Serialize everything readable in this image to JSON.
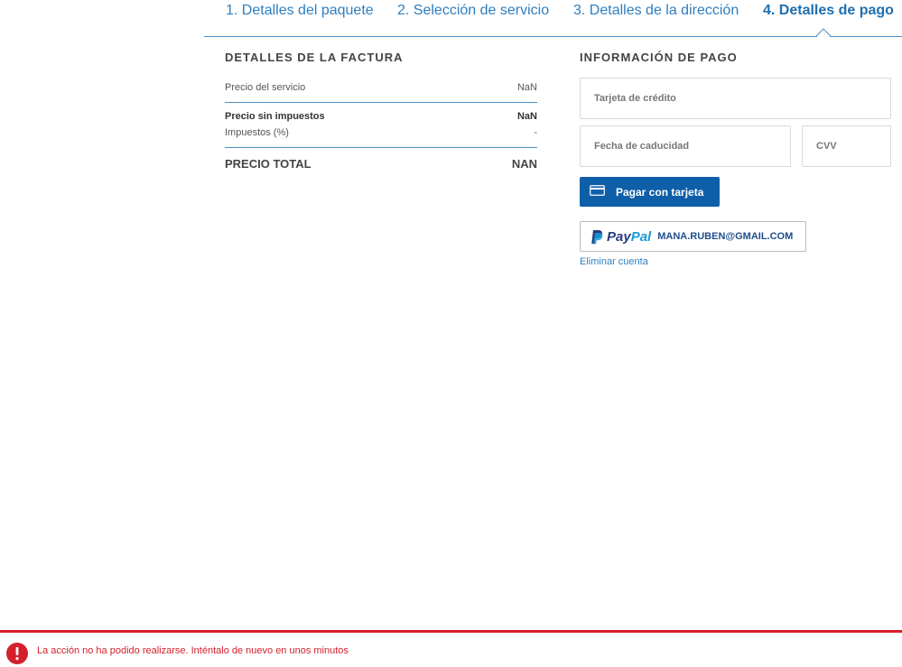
{
  "steps": [
    {
      "label": "1. Detalles del paquete"
    },
    {
      "label": "2. Selección de servicio"
    },
    {
      "label": "3. Detalles de la dirección"
    },
    {
      "label": "4. Detalles de pago",
      "active": true
    }
  ],
  "invoice": {
    "title": "DETALLES DE LA FACTURA",
    "service_price_label": "Precio del servicio",
    "service_price_value": "NaN",
    "pre_tax_label": "Precio sin impuestos",
    "pre_tax_value": "NaN",
    "tax_label": "Impuestos (%)",
    "tax_value": "-",
    "total_label": "PRECIO TOTAL",
    "total_value": "NAN"
  },
  "payment": {
    "title": "INFORMACIÓN DE PAGO",
    "card_placeholder": "Tarjeta de crédito",
    "expiry_placeholder": "Fecha de caducidad",
    "cvv_placeholder": "CVV",
    "pay_button_label": "Pagar con tarjeta",
    "paypal_pay": "Pay",
    "paypal_pal": "Pal",
    "paypal_email": "MANA.RUBEN@GMAIL.COM",
    "delete_account_label": "Eliminar cuenta"
  },
  "error": {
    "message": "La acción no ha podido realizarse. Inténtalo de nuevo en unos minutos"
  },
  "colors": {
    "accent": "#2e7ebf",
    "primary_button": "#0f5fa8",
    "error": "#d4202b"
  }
}
